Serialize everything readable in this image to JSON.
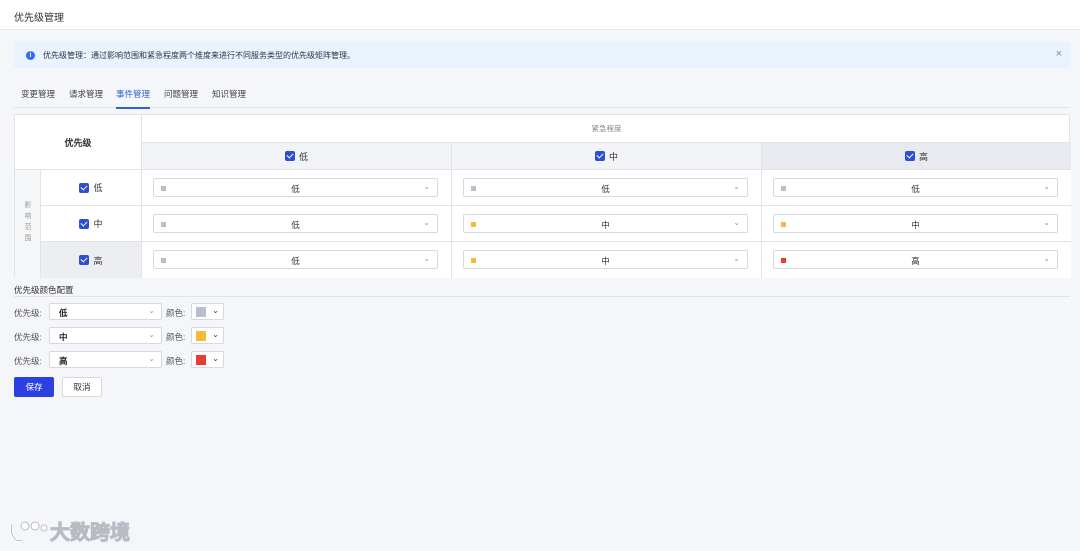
{
  "header": {
    "title": "优先级管理"
  },
  "alert": {
    "message": "优先级管理：通过影响范围和紧急程度两个维度来进行不同服务类型的优先级矩阵管理。",
    "close_glyph": "×"
  },
  "tabs": [
    {
      "label": "变更管理",
      "active": false
    },
    {
      "label": "请求管理",
      "active": false
    },
    {
      "label": "事件管理",
      "active": true
    },
    {
      "label": "问题管理",
      "active": false
    },
    {
      "label": "知识管理",
      "active": false
    }
  ],
  "matrix": {
    "corner_label": "优先级",
    "urgency_label": "紧急程度",
    "impact_label": "影响范围",
    "impact_chars": [
      "影",
      "响",
      "范",
      "围"
    ],
    "columns": [
      {
        "label": "低",
        "checked": true
      },
      {
        "label": "中",
        "checked": true
      },
      {
        "label": "高",
        "checked": true
      }
    ],
    "rows": [
      {
        "label": "低",
        "checked": true,
        "cells": [
          "低",
          "低",
          "低"
        ]
      },
      {
        "label": "中",
        "checked": true,
        "cells": [
          "低",
          "中",
          "中"
        ]
      },
      {
        "label": "高",
        "checked": true,
        "cells": [
          "低",
          "中",
          "高"
        ]
      }
    ]
  },
  "colors": {
    "低": "#b7bfca",
    "中": "#f7b93a",
    "高": "#e53d35",
    "accent": "#2c63d8",
    "primary_button": "#2c3fe0"
  },
  "color_config": {
    "title": "优先级颜色配置",
    "priority_label": "优先级:",
    "color_label": "颜色:",
    "rows": [
      {
        "priority": "低",
        "color": "#b7bfca"
      },
      {
        "priority": "中",
        "color": "#f7b93a"
      },
      {
        "priority": "高",
        "color": "#e53d35"
      }
    ]
  },
  "buttons": {
    "save": "保存",
    "cancel": "取消"
  },
  "watermark": {
    "text": "大数跨境"
  },
  "icons": {
    "info": "info-icon",
    "close": "close-icon",
    "chevron": "chevron-down-icon",
    "checkbox": "checkbox-icon"
  }
}
